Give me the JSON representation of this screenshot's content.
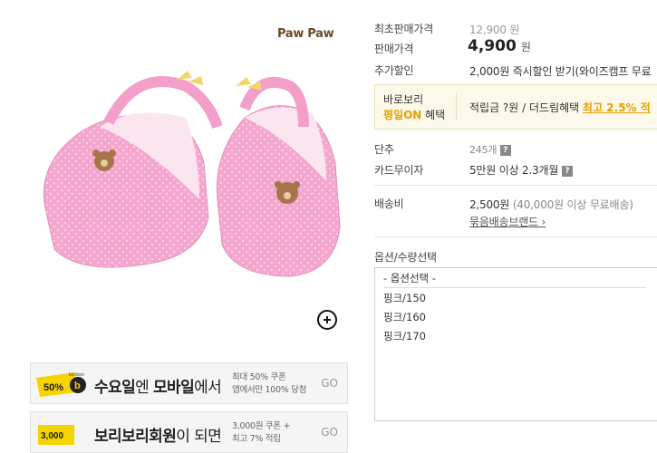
{
  "product": {
    "brand": "Paw Paw",
    "zoom_icon": "zoom-plus-icon"
  },
  "banners": [
    {
      "coupon_percent": "50%",
      "coupon_brand": "boribori",
      "main_parts": [
        "수요일",
        "엔 ",
        "모바일",
        "에서"
      ],
      "sub_line1": "최대 50% 쿠폰",
      "sub_line2": "앱에서만 100% 당첨",
      "go": "GO"
    },
    {
      "coupon_percent": "3,000",
      "main_parts": [
        "보리보리회원",
        "이 되면"
      ],
      "sub_line1": "3,000원 쿠폰 +",
      "sub_line2": "최고 7% 적립",
      "go": "GO"
    }
  ],
  "info": {
    "original_price_label": "최초판매가격",
    "original_price": "12,900 원",
    "sale_price_label": "판매가격",
    "sale_price": "4,900",
    "sale_price_unit": "원",
    "extra_discount_label": "추가할인",
    "extra_discount": "2,000원 즉시할인 받기(와이즈캠프 무료",
    "boribori_line1": "바로보리",
    "boribori_line2_highlight": "평일ON",
    "boribori_line2_rest": " 혜택",
    "benefit_text": "적립금 ?원 / 더드림혜택 ",
    "benefit_highlight": "최고 2.5% 적",
    "point_label": "단추",
    "point_value": "245개",
    "card_label": "카드무이자",
    "card_value": "5만원 이상 2.3개월",
    "shipping_label": "배송비",
    "shipping_fee": "2,500원",
    "shipping_note": " (40,000원 이상 무료배송)",
    "bundle_link": "묶음배송브랜드 ›",
    "help_icon": "question-icon"
  },
  "options": {
    "label": "옵션/수량선택",
    "placeholder": "- 옵션선택 -",
    "items": [
      "핑크/150",
      "핑크/160",
      "핑크/170"
    ]
  }
}
